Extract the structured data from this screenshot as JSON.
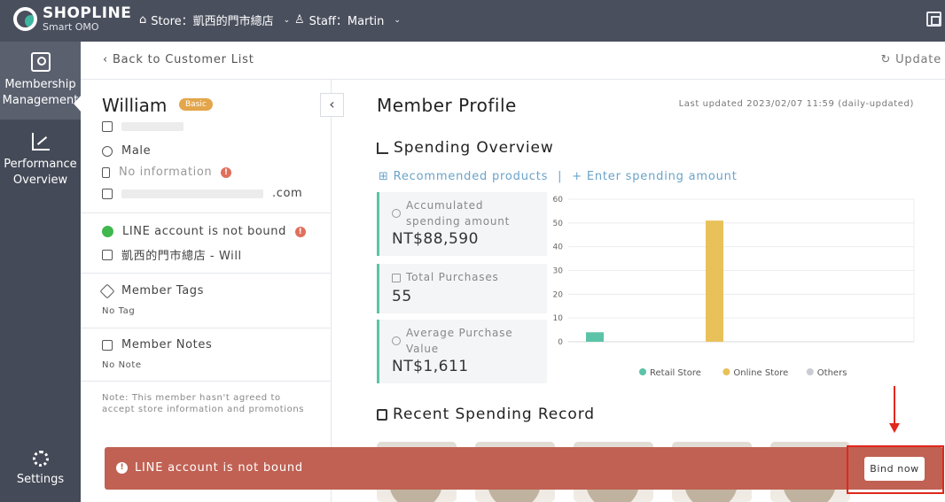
{
  "header": {
    "brand": "SHOPLINE",
    "brand_sub": "Smart OMO",
    "store_label": "Store：凱西的門市總店",
    "staff_label": "Staff：Martin"
  },
  "sidebar": {
    "items": [
      {
        "label_line1": "Membership",
        "label_line2": "Management",
        "icon": "membership-icon"
      },
      {
        "label_line1": "Performance",
        "label_line2": "Overview",
        "icon": "performance-icon"
      },
      {
        "label": "Settings",
        "icon": "gear-icon"
      }
    ]
  },
  "nav": {
    "back_label": "Back to Customer List",
    "update_label": "Update"
  },
  "member": {
    "name": "William",
    "tier": "Basic",
    "gender": "Male",
    "phone": "No information",
    "email_suffix": ".com",
    "line_status": "LINE account is not bound",
    "store": "凱西的門市總店 - Will",
    "tags_title": "Member Tags",
    "tags_value": "No Tag",
    "notes_title": "Member Notes",
    "notes_value": "No Note",
    "consent_note": "Note: This member hasn't agreed to accept store information and promotions"
  },
  "profile": {
    "title": "Member Profile",
    "last_updated": "Last updated 2023/02/07 11:59 (daily-updated)",
    "spending_title": "Spending Overview",
    "link_recommended": "Recommended products",
    "link_divider": "|",
    "link_enter": "+ Enter spending amount",
    "recent_title": "Recent Spending Record"
  },
  "stats": [
    {
      "label_line1": "Accumulated",
      "label_line2": "spending amount",
      "value": "NT$88,590"
    },
    {
      "label_line1": "Total Purchases",
      "label_line2": "",
      "value": "55"
    },
    {
      "label_line1": "Average Purchase",
      "label_line2": "Value",
      "value": "NT$1,611"
    }
  ],
  "chart_data": {
    "type": "bar",
    "categories": [
      "Retail Store",
      "Online Store",
      "Others"
    ],
    "values": [
      4,
      51,
      0
    ],
    "colors": [
      "#5cc3a8",
      "#e8c15a",
      "#c9ccd3"
    ],
    "ylim": [
      0,
      60
    ],
    "yticks": [
      0,
      10,
      20,
      30,
      40,
      50,
      60
    ],
    "legend": [
      "Retail Store",
      "Online Store",
      "Others"
    ],
    "legend_position": "bottom",
    "grid": true
  },
  "toast": {
    "message": "LINE account is not bound",
    "button": "Bind now"
  }
}
